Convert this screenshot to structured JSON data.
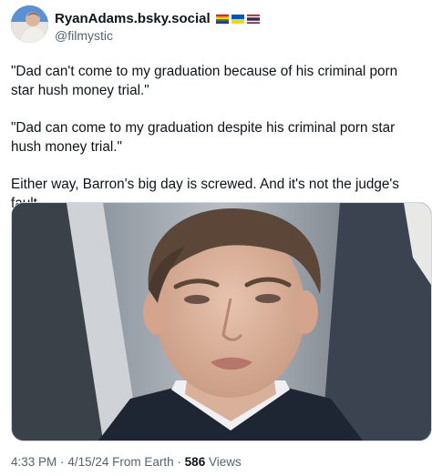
{
  "author": {
    "display_name": "RyanAdams.bsky.social",
    "handle": "@filmystic",
    "flag_icons": [
      "rainbow-flag-icon",
      "ukraine-flag-icon",
      "thailand-flag-icon"
    ]
  },
  "tweet": {
    "paragraphs": [
      "\"Dad can't come to my graduation because of his criminal porn star hush money trial.\"",
      "\"Dad can come to my graduation despite his criminal porn star hush money trial.\"",
      "Either way, Barron's big day is screwed. And it's not the judge's fault."
    ]
  },
  "meta": {
    "time": "4:33 PM",
    "separator": "·",
    "date": "4/15/24",
    "location": "From Earth",
    "views_count": "586",
    "views_label": "Views"
  },
  "colors": {
    "text": "#0f1419",
    "secondary": "#536471",
    "border": "#cfd9de"
  }
}
